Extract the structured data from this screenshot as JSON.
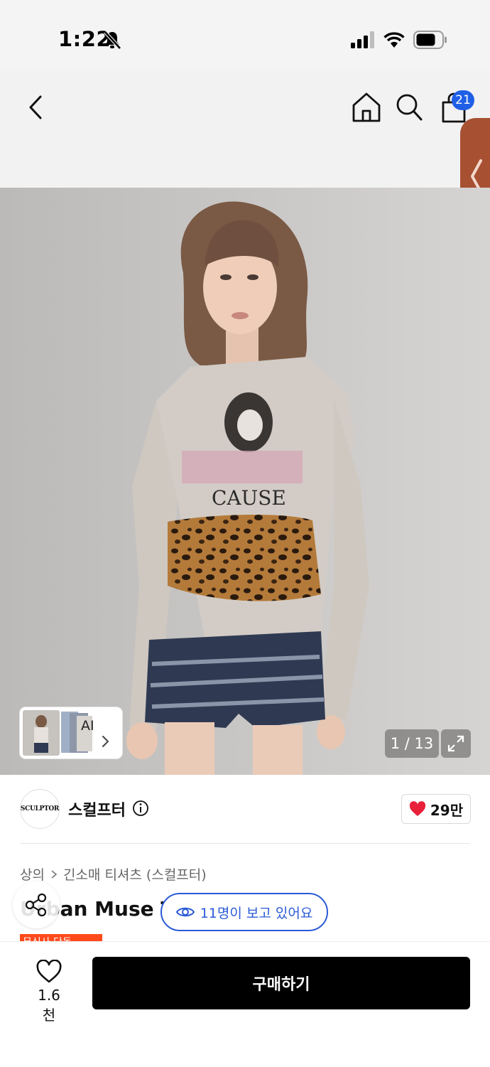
{
  "status_bar": {
    "time": "1:22",
    "icons": [
      "bell-off-icon",
      "signal-icon",
      "wifi-icon",
      "battery-icon"
    ]
  },
  "nav": {
    "icons": [
      "back-icon",
      "home-icon",
      "search-icon",
      "cart-icon",
      "chevron-left-icon"
    ],
    "cart_badge": "21"
  },
  "gallery": {
    "ai_label": "AI",
    "counter": "1 / 13",
    "icons": [
      "chevron-right-icon",
      "expand-icon"
    ]
  },
  "brand": {
    "name": "스컬프터",
    "logo_text": "SCULPTOR",
    "like_count": "29만",
    "icons": [
      "info-icon",
      "heart-icon"
    ]
  },
  "product": {
    "breadcrumb": [
      "상의",
      "긴소매 티셔츠 (스컬프터)"
    ],
    "title": "Urban Muse Tee",
    "viewers": "11명이 보고 있어요",
    "promo_badge": "무신사 단독",
    "icons": [
      "share-icon",
      "eye-icon"
    ]
  },
  "bottom_bar": {
    "wishlist_count": "1.6천",
    "buy_label": "구매하기",
    "icons": [
      "heart-outline-icon"
    ]
  },
  "colors": {
    "accent_blue": "#2b5bd7",
    "badge_blue": "#1f5fe6",
    "like_red": "#e8203a",
    "drawer_brown": "#a75132",
    "promo_orange": "#ff4a1c",
    "buy_black": "#000000"
  }
}
